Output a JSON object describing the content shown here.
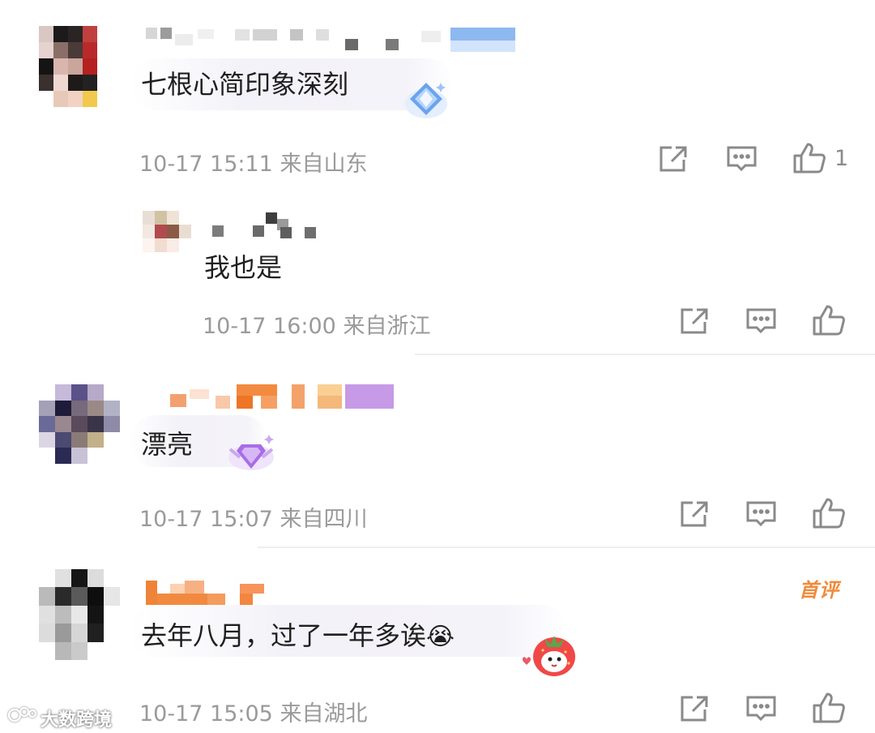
{
  "comments": [
    {
      "text": "七根心简印象深刻",
      "timestamp": "10-17 15:11",
      "location": "来自山东",
      "like_count": "1",
      "reply": {
        "text": "我也是",
        "timestamp": "10-17 16:00",
        "location": "来自浙江"
      }
    },
    {
      "text": "漂亮",
      "timestamp": "10-17 15:07",
      "location": "来自四川"
    },
    {
      "text": "去年八月，过了一年多诶",
      "emoji": "😭",
      "timestamp": "10-17 15:05",
      "location": "来自湖北",
      "badge": "首评"
    }
  ],
  "watermark": "大数跨境",
  "icons": {
    "share": "share-icon",
    "comment": "comment-icon",
    "like": "thumbs-up-icon"
  },
  "colors": {
    "meta": "#9a9a9a",
    "badge": "#f08a3c",
    "icon": "#8a8a8a"
  }
}
